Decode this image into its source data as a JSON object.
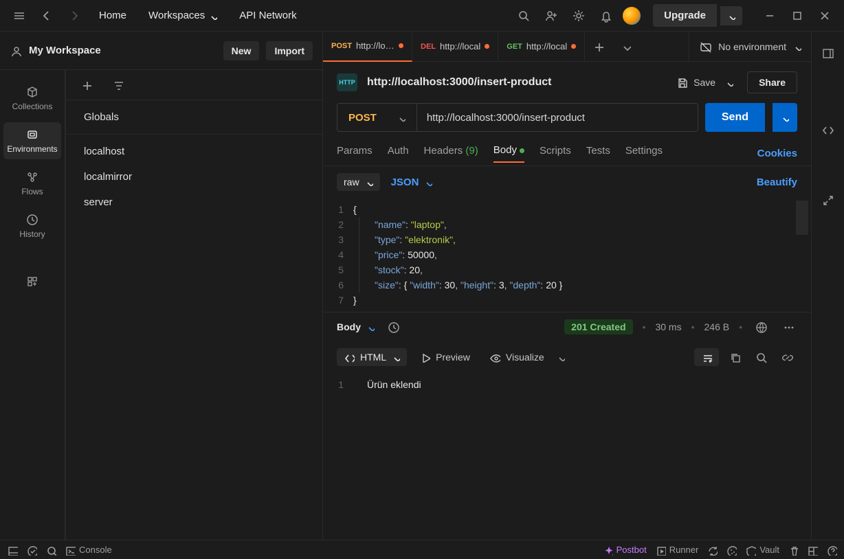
{
  "topbar": {
    "home": "Home",
    "workspaces": "Workspaces",
    "api_network": "API Network",
    "upgrade": "Upgrade"
  },
  "workspace": {
    "name": "My Workspace",
    "new_btn": "New",
    "import_btn": "Import"
  },
  "far_left": {
    "collections": "Collections",
    "environments": "Environments",
    "flows": "Flows",
    "history": "History"
  },
  "env_list": {
    "globals": "Globals",
    "items": [
      "localhost",
      "localmirror",
      "server"
    ]
  },
  "tabs": [
    {
      "method": "POST",
      "color": "#ffb74d",
      "url": "http://loca",
      "active": true
    },
    {
      "method": "DEL",
      "color": "#ef5350",
      "url": "http://local",
      "active": false
    },
    {
      "method": "GET",
      "color": "#66bb6a",
      "url": "http://local",
      "active": false
    }
  ],
  "no_env": "No environment",
  "request": {
    "title": "http://localhost:3000/insert-product",
    "save": "Save",
    "share": "Share",
    "method": "POST",
    "url": "http://localhost:3000/insert-product",
    "send": "Send"
  },
  "req_tabs": {
    "params": "Params",
    "auth": "Auth",
    "headers": "Headers",
    "headers_count": "(9)",
    "body": "Body",
    "scripts": "Scripts",
    "tests": "Tests",
    "settings": "Settings",
    "cookies": "Cookies"
  },
  "body_opts": {
    "raw": "raw",
    "json": "JSON",
    "beautify": "Beautify"
  },
  "body_json": {
    "name": "laptop",
    "type": "elektronik",
    "price": 50000,
    "stock": 20,
    "size": {
      "width": 30,
      "height": 3,
      "depth": 20
    }
  },
  "response": {
    "body_label": "Body",
    "status": "201 Created",
    "time": "30 ms",
    "size": "246 B",
    "html": "HTML",
    "preview": "Preview",
    "visualize": "Visualize",
    "text": "Ürün eklendi"
  },
  "footer": {
    "console": "Console",
    "postbot": "Postbot",
    "runner": "Runner",
    "vault": "Vault"
  }
}
